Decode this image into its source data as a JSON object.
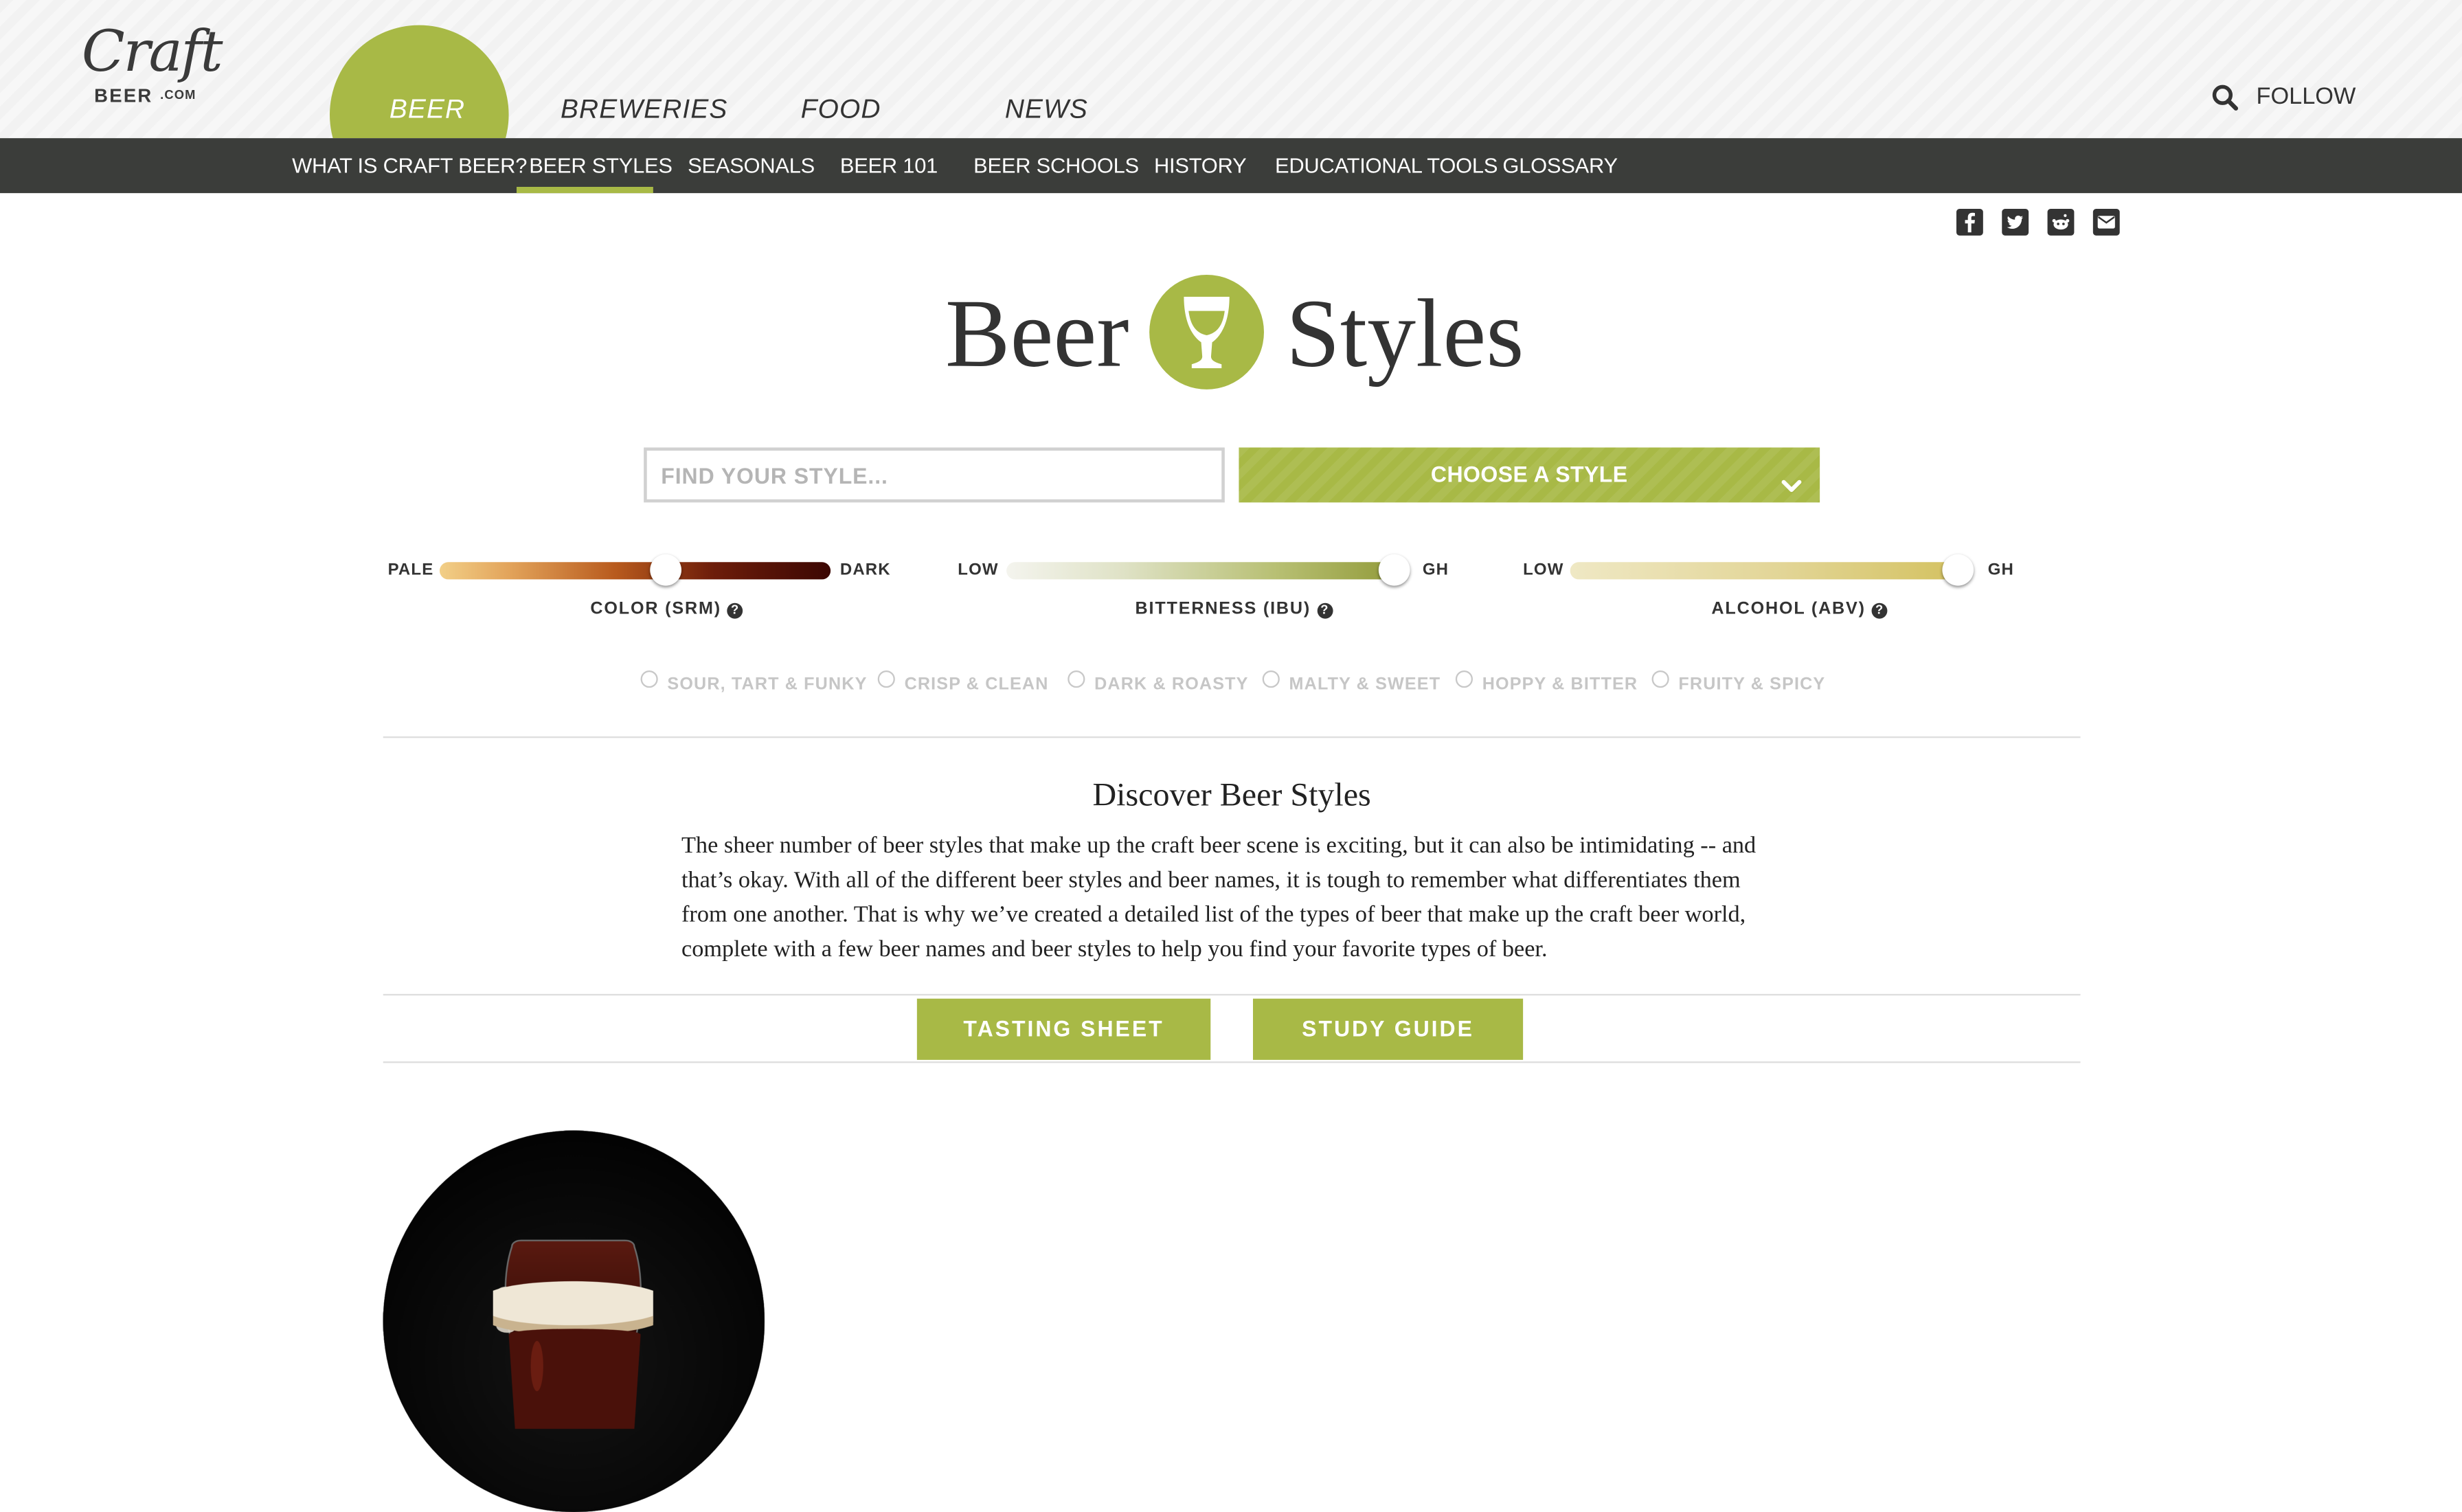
{
  "header": {
    "logo_text": "Craft",
    "logo_sub": "BEER",
    "logo_com": ".COM",
    "main_nav": [
      {
        "label": "BEER",
        "active": true
      },
      {
        "label": "BREWERIES"
      },
      {
        "label": "FOOD"
      },
      {
        "label": "NEWS"
      }
    ],
    "search_icon": "search-icon",
    "follow_label": "FOLLOW"
  },
  "subnav": {
    "items": [
      {
        "label": "WHAT IS CRAFT BEER?"
      },
      {
        "label": "BEER STYLES",
        "active": true
      },
      {
        "label": "SEASONALS"
      },
      {
        "label": "BEER 101"
      },
      {
        "label": "BEER SCHOOLS"
      },
      {
        "label": "HISTORY"
      },
      {
        "label": "EDUCATIONAL TOOLS"
      },
      {
        "label": "GLOSSARY"
      }
    ]
  },
  "social": [
    "facebook-icon",
    "twitter-icon",
    "reddit-icon",
    "email-icon"
  ],
  "hero": {
    "word_left": "Beer",
    "word_right": "Styles",
    "icon": "beer-glass-icon"
  },
  "search": {
    "placeholder": "FIND YOUR STYLE...",
    "value": "",
    "choose_label": "CHOOSE A STYLE"
  },
  "sliders": [
    {
      "low": "PALE",
      "high": "DARK",
      "label": "COLOR (SRM)",
      "position": 0.58
    },
    {
      "low": "LOW",
      "high": "GH",
      "label": "BITTERNESS (IBU)",
      "position": 1.0
    },
    {
      "low": "LOW",
      "high": "GH",
      "label": "ALCOHOL (ABV)",
      "position": 1.0
    }
  ],
  "flavors": [
    {
      "label": "SOUR, TART & FUNKY",
      "checked": false
    },
    {
      "label": "CRISP & CLEAN",
      "checked": false
    },
    {
      "label": "DARK & ROASTY",
      "checked": false
    },
    {
      "label": "MALTY & SWEET",
      "checked": false
    },
    {
      "label": "HOPPY & BITTER",
      "checked": false
    },
    {
      "label": "FRUITY & SPICY",
      "checked": false
    }
  ],
  "discover": {
    "title": "Discover Beer Styles",
    "body": "The sheer number of beer styles that make up the craft beer scene is exciting, but it can also be intimidating -- and that’s okay. With all of the different beer styles and beer names, it is tough to remember what differentiates them from one another. That is why we’ve created a detailed list of the types of beer that make up the craft beer world, complete with a few beer names and beer styles to help you find your favorite types of beer."
  },
  "actions": {
    "tasting_sheet": "TASTING SHEET",
    "study_guide": "STUDY GUIDE"
  },
  "colors": {
    "accent": "#a8b946",
    "subnav_bg": "#3b3d3a",
    "text": "#333333"
  }
}
